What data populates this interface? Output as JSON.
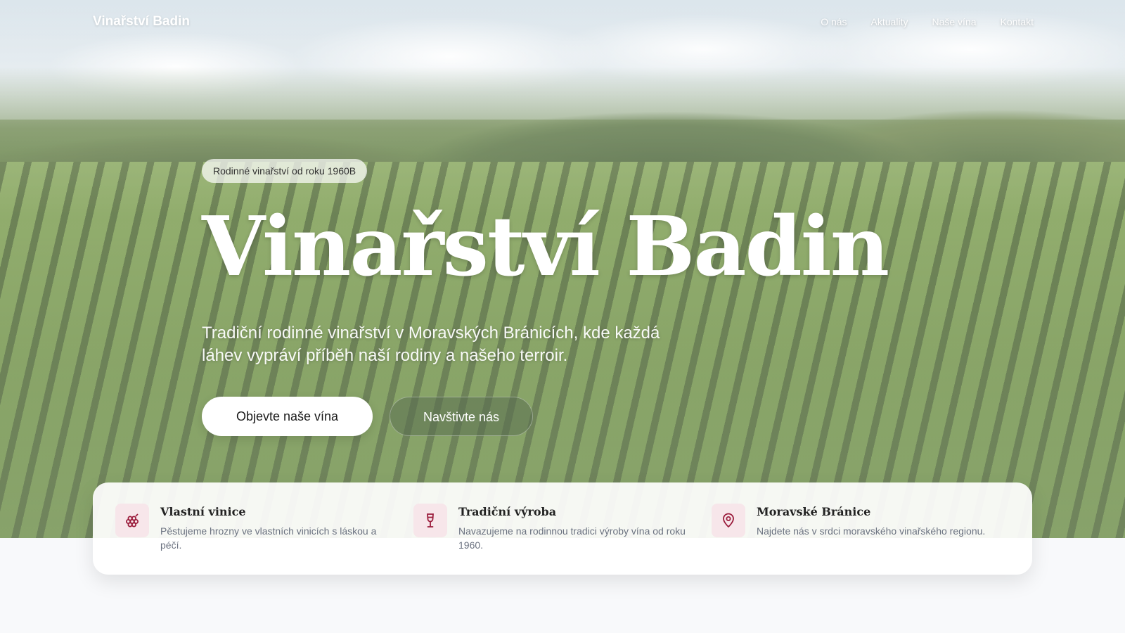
{
  "nav": {
    "brand": "Vinařství Badin",
    "links": [
      "O nás",
      "Aktuality",
      "Naše vína",
      "Kontakt"
    ]
  },
  "hero": {
    "badge": "Rodinné vinařství od roku 1960B",
    "title": "Vinařství Badin",
    "subtitle": "Tradiční rodinné vinařství v Moravských Bránicích, kde každá láhev vypráví příběh naší rodiny a našeho terroir.",
    "primary_button": "Objevte naše vína",
    "secondary_button": "Navštivte nás"
  },
  "features": [
    {
      "icon": "grapes-icon",
      "title": "Vlastní vinice",
      "description": "Pěstujeme hrozny ve vlastních vinicích s láskou a péčí."
    },
    {
      "icon": "wine-glass-icon",
      "title": "Tradiční výroba",
      "description": "Navazujeme na rodinnou tradici výroby vína od roku 1960."
    },
    {
      "icon": "map-pin-icon",
      "title": "Moravské Bránice",
      "description": "Najdete nás v srdci moravského vinařského regionu."
    }
  ],
  "colors": {
    "accent": "#9b1c3c",
    "icon_bg": "#f7e6ea"
  }
}
